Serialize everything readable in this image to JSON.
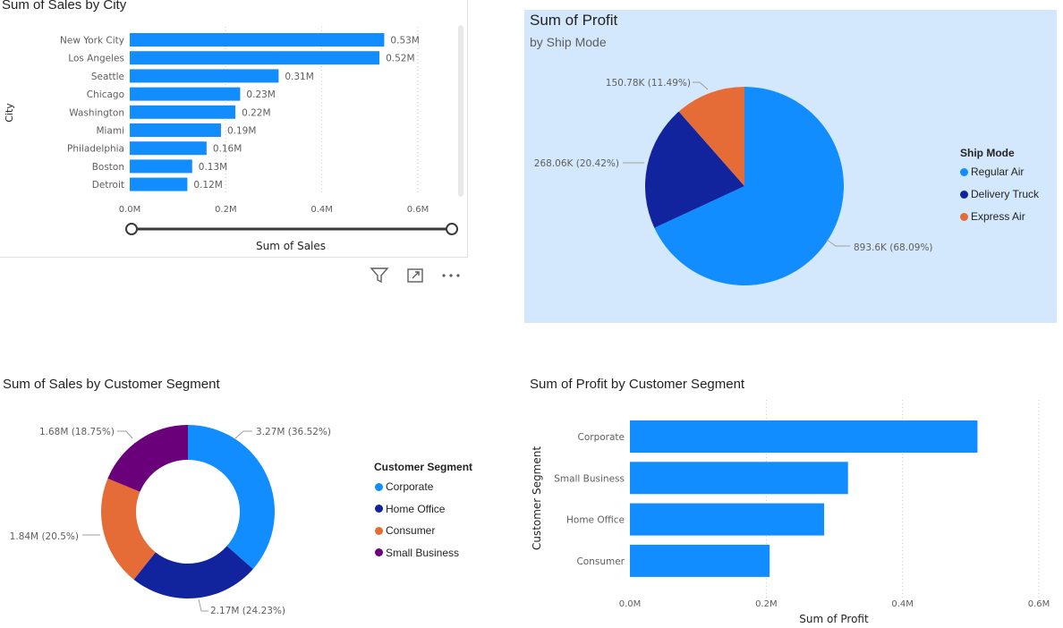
{
  "visuals": {
    "city": {
      "title": "Sum of Sales by City",
      "ylabel": "City",
      "xlabel": "Sum of Sales"
    },
    "shipmode": {
      "title": "Sum of Profit",
      "subtitle": "by Ship Mode",
      "legend_title": "Ship Mode"
    },
    "segment_donut": {
      "title": "Sum of Sales by Customer Segment",
      "legend_title": "Customer Segment"
    },
    "segment_bar": {
      "title": "Sum of Profit by Customer Segment",
      "ylabel": "Customer Segment",
      "xlabel": "Sum of Profit"
    }
  },
  "toolbar": {
    "filter_icon": "filter-icon",
    "focus_icon": "focus-mode-icon",
    "more_icon": "more-options-icon"
  },
  "colors": {
    "primary": "#118DFF",
    "dark_blue": "#12239E",
    "orange": "#E66C37",
    "purple": "#6B007B",
    "selected_bg": "#D3E8FC"
  },
  "chart_data": [
    {
      "id": "sales_by_city",
      "type": "bar",
      "orientation": "horizontal",
      "title": "Sum of Sales by City",
      "xlabel": "Sum of Sales",
      "ylabel": "City",
      "categories": [
        "New York City",
        "Los Angeles",
        "Seattle",
        "Chicago",
        "Washington",
        "Miami",
        "Philadelphia",
        "Boston",
        "Detroit"
      ],
      "values": [
        0.53,
        0.52,
        0.31,
        0.23,
        0.22,
        0.19,
        0.16,
        0.13,
        0.12
      ],
      "data_labels": [
        "0.53M",
        "0.52M",
        "0.31M",
        "0.23M",
        "0.22M",
        "0.19M",
        "0.16M",
        "0.13M",
        "0.12M"
      ],
      "xticks": [
        "0.0M",
        "0.2M",
        "0.4M",
        "0.6M"
      ],
      "xlim": [
        0,
        0.6
      ],
      "color": "#118DFF",
      "grid": true
    },
    {
      "id": "profit_by_shipmode",
      "type": "pie",
      "title": "Sum of Profit",
      "subtitle": "by Ship Mode",
      "labels": [
        "Regular Air",
        "Delivery Truck",
        "Express Air"
      ],
      "values": [
        893.6,
        268.06,
        150.78
      ],
      "data_labels": [
        "893.6K (68.09%)",
        "268.06K (20.42%)",
        "150.78K (11.49%)"
      ],
      "colors": [
        "#118DFF",
        "#12239E",
        "#E66C37"
      ],
      "legend": "right"
    },
    {
      "id": "sales_by_segment",
      "type": "pie",
      "style": "donut",
      "title": "Sum of Sales by Customer Segment",
      "labels": [
        "Corporate",
        "Home Office",
        "Consumer",
        "Small Business"
      ],
      "values": [
        3.27,
        2.17,
        1.84,
        1.68
      ],
      "data_labels": [
        "3.27M (36.52%)",
        "2.17M (24.23%)",
        "1.84M (20.5%)",
        "1.68M (18.75%)"
      ],
      "colors": [
        "#118DFF",
        "#12239E",
        "#E66C37",
        "#6B007B"
      ],
      "legend": "right"
    },
    {
      "id": "profit_by_segment",
      "type": "bar",
      "orientation": "horizontal",
      "title": "Sum of Profit by Customer Segment",
      "xlabel": "Sum of Profit",
      "ylabel": "Customer Segment",
      "categories": [
        "Corporate",
        "Small Business",
        "Home Office",
        "Consumer"
      ],
      "values": [
        0.51,
        0.32,
        0.285,
        0.205
      ],
      "xticks": [
        "0.0M",
        "0.2M",
        "0.4M",
        "0.6M"
      ],
      "xlim": [
        0,
        0.6
      ],
      "color": "#118DFF",
      "grid": true
    }
  ]
}
